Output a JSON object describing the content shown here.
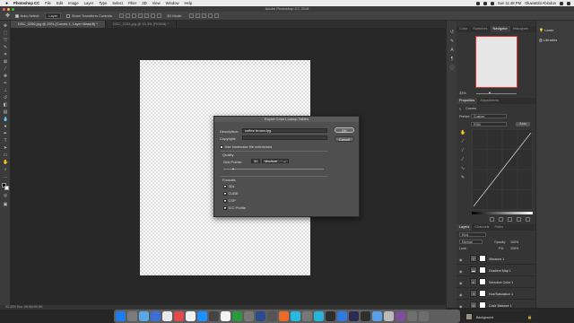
{
  "menubar": {
    "app": "Photoshop CC",
    "items": [
      "File",
      "Edit",
      "Image",
      "Layer",
      "Type",
      "Select",
      "Filter",
      "3D",
      "View",
      "Window",
      "Help"
    ],
    "clock": "Sun 11:48 PM",
    "user": "Oluwatobi Abiodun"
  },
  "titlebar": {
    "title": "Adobe Photoshop CC 2018"
  },
  "options": {
    "auto_select_label": "Auto-Select:",
    "auto_select_value": "Layer",
    "transform_controls_label": "Show Transform Controls",
    "mode_3d_label": "3D Mode:"
  },
  "tabs": [
    {
      "label": "DSC_0266.jpg @ 25% (Curves 1, Layer Mask/8) *",
      "active": true
    },
    {
      "label": "DSC_0254.jpg @ 33.3% (RGB/8) *",
      "active": false
    }
  ],
  "status": {
    "text": "33.33%   Doc: 68.5M/99.9M"
  },
  "dialog": {
    "title": "Export Color Lookup Tables",
    "description_label": "Description:",
    "description_value": "coffee brown.lpg",
    "copyright_label": "Copyright:",
    "copyright_value": "",
    "lowercase_label": "Use lowercase file extensions",
    "quality_label": "Quality",
    "grid_points_label": "Grid Points:",
    "grid_points_value": "32",
    "grid_points_preset": "Medium",
    "formats_label": "Formats",
    "formats": [
      {
        "label": "3DL",
        "checked": true
      },
      {
        "label": "CUBE",
        "checked": true
      },
      {
        "label": "CSP",
        "checked": true
      },
      {
        "label": "ICC Profile",
        "checked": true
      }
    ],
    "ok_label": "OK",
    "cancel_label": "Cancel"
  },
  "navigator": {
    "tabs": [
      "Color",
      "Swatches",
      "Navigator",
      "Histogram"
    ],
    "active": "Navigator",
    "zoom": "33%"
  },
  "properties": {
    "tabs": [
      "Properties",
      "Adjustments"
    ],
    "title": "Curves",
    "preset_label": "Preset:",
    "preset_value": "Custom",
    "channel": "RGB",
    "auto_label": "Auto"
  },
  "layers_panel": {
    "tabs": [
      "Layers",
      "Channels",
      "Paths"
    ],
    "kind_label": "Kind",
    "blend_mode": "Normal",
    "opacity_label": "Opacity:",
    "opacity_value": "100%",
    "lock_label": "Lock:",
    "fill_label": "Fill:",
    "fill_value": "100%",
    "layers": [
      {
        "name": "Vibrance 1",
        "thumb": "▽"
      },
      {
        "name": "Gradient Map 1",
        "thumb": "▬"
      },
      {
        "name": "Selective Color 1",
        "thumb": "◐"
      },
      {
        "name": "Hue/Saturation 1",
        "thumb": "◑"
      },
      {
        "name": "Color Balance 1",
        "thumb": "⚖"
      },
      {
        "name": "Background",
        "thumb": ""
      }
    ]
  },
  "farright": {
    "items": [
      "Learn",
      "Libraries"
    ]
  },
  "colors": {
    "dock": [
      "#1e7cf2",
      "#7b7b7b",
      "#58a8e8",
      "#3b6fd8",
      "#e9e9e9",
      "#e34b4b",
      "#f0f0f0",
      "#1e90ff",
      "#444",
      "#f2f2f2",
      "#2b9a3e",
      "#777",
      "#2a4b8c",
      "#555",
      "#e96b2a",
      "#27b8e4",
      "#777",
      "#26b5d9",
      "#2d2d2d",
      "#2d7be0",
      "#2a2a52",
      "#2f2f2f",
      "#5aa0e8",
      "#bbb",
      "#7c4e9d",
      "#6f6f6f",
      "#6e6e6e"
    ]
  }
}
